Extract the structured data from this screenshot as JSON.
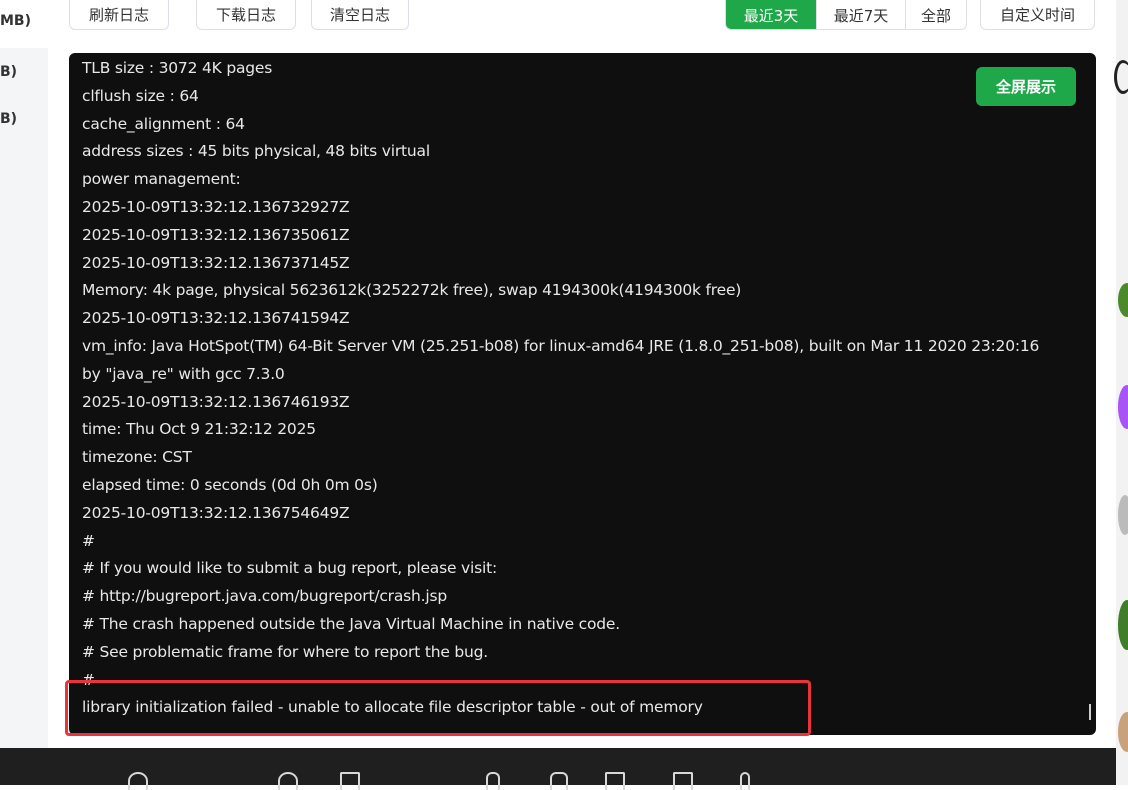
{
  "sidebar": {
    "labels": [
      "MB)",
      "B)",
      "B)"
    ]
  },
  "toolbar": {
    "refresh_label": "刷新日志",
    "download_label": "下载日志",
    "clear_label": "清空日志",
    "range_options": [
      "最近3天",
      "最近7天",
      "全部"
    ],
    "range_selected": "最近3天",
    "custom_time_label": "自定义时间"
  },
  "console": {
    "fullscreen_label": "全屏展示",
    "lines": [
      "TLB size : 3072 4K pages",
      "clflush size : 64",
      "cache_alignment : 64",
      "address sizes : 45 bits physical, 48 bits virtual",
      "power management:",
      "2025-10-09T13:32:12.136732927Z",
      "2025-10-09T13:32:12.136735061Z",
      "2025-10-09T13:32:12.136737145Z",
      "Memory: 4k page, physical 5623612k(3252272k free), swap 4194300k(4194300k free)",
      "2025-10-09T13:32:12.136741594Z",
      "vm_info: Java HotSpot(TM) 64-Bit Server VM (25.251-b08) for linux-amd64 JRE (1.8.0_251-b08), built on Mar 11 2020 23:20:16",
      "by \"java_re\" with gcc 7.3.0",
      "2025-10-09T13:32:12.136746193Z",
      "time: Thu Oct 9 21:32:12 2025",
      "timezone: CST",
      "elapsed time: 0 seconds (0d 0h 0m 0s)",
      "2025-10-09T13:32:12.136754649Z",
      "#",
      "# If you would like to submit a bug report, please visit:",
      "# http://bugreport.java.com/bugreport/crash.jsp",
      "# The crash happened outside the Java Virtual Machine in native code.",
      "# See problematic frame for where to report the bug.",
      "#",
      "library initialization failed - unable to allocate file descriptor table - out of memory"
    ]
  },
  "colors": {
    "accent": "#1fa84a",
    "console_bg": "#0f0f0f",
    "highlight": "#e8343a"
  }
}
